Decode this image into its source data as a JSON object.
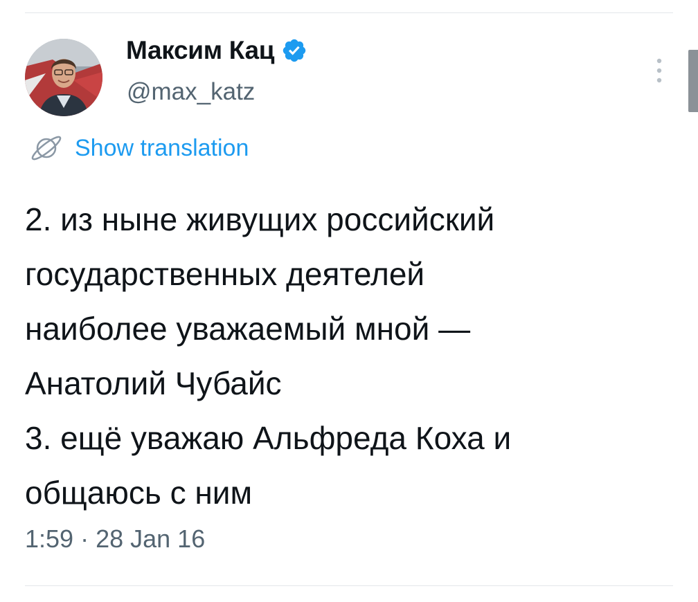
{
  "author": {
    "display_name": "Максим Кац",
    "handle": "@max_katz",
    "verified": true,
    "avatar_icon": "profile-photo"
  },
  "actions": {
    "more_icon": "vertical-ellipsis-icon"
  },
  "translation": {
    "icon": "globe-icon",
    "label": "Show translation"
  },
  "tweet": {
    "lines": [
      "2. из ныне живущих российский",
      "государственных деятелей",
      "наиболее уважаемый мной —",
      "Анатолий Чубайс",
      "3. ещё уважаю Альфреда Коха и",
      "общаюсь с ним"
    ]
  },
  "meta": {
    "time": "1:59",
    "separator": " · ",
    "date": "28 Jan 16"
  },
  "colors": {
    "accent": "#1d9bf0",
    "text": "#0f1419",
    "secondary": "#536471",
    "divider": "#e3e7ea"
  }
}
